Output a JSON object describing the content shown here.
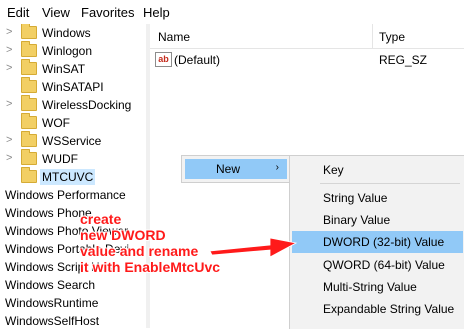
{
  "menubar": {
    "items": [
      "Edit",
      "View",
      "Favorites",
      "Help"
    ]
  },
  "tree": {
    "folders": [
      "Windows",
      "Winlogon",
      "WinSAT",
      "WinSATAPI",
      "WirelessDocking",
      "WOF",
      "WSService",
      "WUDF",
      "MTCUVC"
    ],
    "selected": "MTCUVC",
    "siblings": [
      "Windows Performance",
      "Windows Phone",
      "Windows Photo Viewer",
      "Windows Portable Devi",
      "Windows Script Host",
      "Windows Search",
      "WindowsRuntime",
      "WindowsSelfHost"
    ]
  },
  "list": {
    "headers": {
      "name": "Name",
      "type": "Type"
    },
    "rows": [
      {
        "icon": "ab",
        "name": "(Default)",
        "type": "REG_SZ"
      }
    ]
  },
  "context_menu": {
    "new_label": "New",
    "new_arrow": "›",
    "items": [
      "Key",
      "String Value",
      "Binary Value",
      "DWORD (32-bit) Value",
      "QWORD (64-bit) Value",
      "Multi-String Value",
      "Expandable String Value"
    ],
    "highlighted": "DWORD (32-bit) Value"
  },
  "annotation": {
    "lines": [
      "create",
      "new DWORD",
      "value and rename",
      "it with EnableMtcUvc"
    ],
    "color": "#ff1a1a"
  },
  "colors": {
    "selection": "#cce8ff",
    "menu_highlight": "#91c9f7",
    "folder": "#f2cf64"
  }
}
